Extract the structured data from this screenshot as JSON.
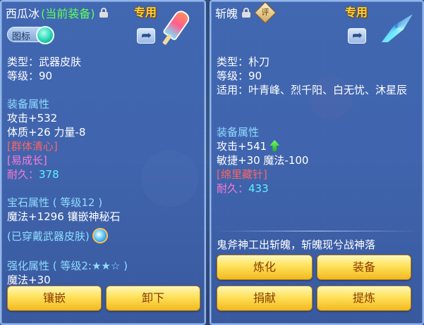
{
  "left": {
    "item_name": "西瓜冰",
    "equipped_tag": "(当前装备)",
    "exclusive_label": "专用",
    "toggle_label": "图标",
    "type": "类型：武器皮肤",
    "level": "等级：90",
    "attr_title": "装备属性",
    "attack": "攻击+532",
    "stats": "体质+26 力量-8",
    "tag_1": "[群体清心]",
    "tag_2": "[易成长]",
    "durability_label": "耐久：",
    "durability_value": "378",
    "gem_title": "宝石属性 ( 等级12 )",
    "gem_stat": "魔法+1296 镶嵌神秘石",
    "skin_worn": "(已穿戴武器皮肤)",
    "enhance_title": "强化属性 ( 等级2:★★☆ )",
    "enhance_stat": "魔法+30",
    "buttons": {
      "inlay": "镶嵌",
      "unequip": "卸下"
    }
  },
  "right": {
    "item_name": "斩魄",
    "stamp_label": "评",
    "exclusive_label": "专用",
    "type": "类型：朴刀",
    "level": "等级：90",
    "suitable": "适用：叶青峰、烈千阳、白无忧、沐星辰",
    "attr_title": "装备属性",
    "attack": "攻击+541",
    "stats": "敏捷+30 魔法-100",
    "tag_1": "[绵里藏针]",
    "durability_label": "耐久：",
    "durability_value": "433",
    "flavor": "鬼斧神工出斩魄，斩魄现兮战神落",
    "buttons": {
      "refine": "炼化",
      "equip": "装备",
      "donate": "捐献",
      "extract": "提炼"
    }
  },
  "icons": {
    "lock": "lock-icon",
    "share": "share-icon",
    "stamp": "stamp-icon",
    "arrow": "up-arrow-icon",
    "gem": "gem-icon"
  },
  "colors": {
    "section": "#8fdcff",
    "purple_tag": "#ff79d4",
    "red_tag": "#ff6464",
    "green": "#5dff5d",
    "gold": "#ffd23a"
  }
}
